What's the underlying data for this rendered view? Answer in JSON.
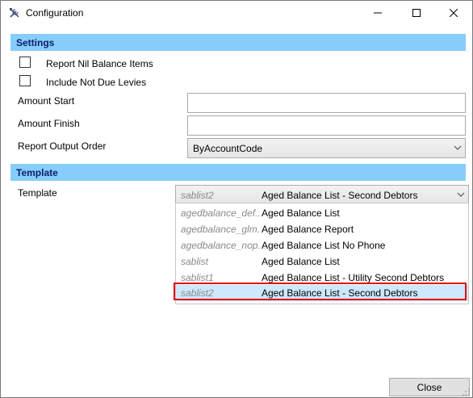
{
  "window": {
    "title": "Configuration"
  },
  "settings": {
    "header": "Settings",
    "report_nil_balance": {
      "label": "Report Nil Balance Items",
      "checked": false
    },
    "include_not_due": {
      "label": "Include Not Due Levies",
      "checked": false
    },
    "amount_start": {
      "label": "Amount Start",
      "value": ""
    },
    "amount_finish": {
      "label": "Amount Finish",
      "value": ""
    },
    "output_order": {
      "label": "Report Output Order",
      "value": "ByAccountCode"
    }
  },
  "template": {
    "header": "Template",
    "label": "Template",
    "selected_code": "sablist2",
    "selected_name": "Aged Balance List - Second Debtors",
    "options": [
      {
        "code": "agedbalance_def...",
        "name": "Aged Balance List"
      },
      {
        "code": "agedbalance_glm...",
        "name": "Aged Balance Report"
      },
      {
        "code": "agedbalance_nop...",
        "name": "Aged Balance List No Phone"
      },
      {
        "code": "sablist",
        "name": "Aged Balance List"
      },
      {
        "code": "sablist1",
        "name": "Aged Balance List - Utility Second Debtors"
      },
      {
        "code": "sablist2",
        "name": "Aged Balance List - Second Debtors"
      }
    ]
  },
  "footer": {
    "close_label": "Close"
  }
}
